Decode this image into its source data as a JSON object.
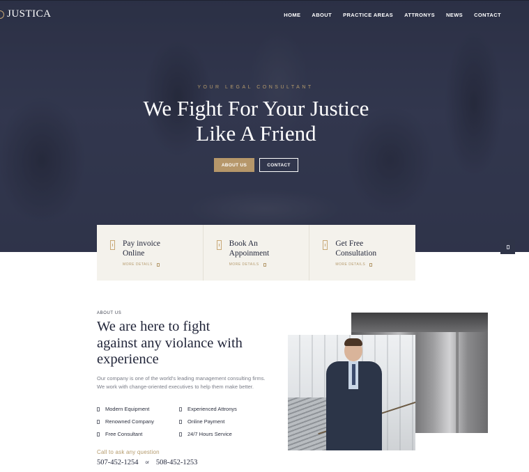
{
  "header": {
    "logo_text": "JUSTICA",
    "nav": [
      "HOME",
      "ABOUT",
      "PRACTICE AREAS",
      "ATTRONYS",
      "NEWS",
      "CONTACT"
    ]
  },
  "hero": {
    "subtitle": "YOUR LEGAL CONSULTANT",
    "title_line1": "We Fight For Your Justice",
    "title_line2": "Like A Friend",
    "about_button": "ABOUT US",
    "contact_button": "CONTACT"
  },
  "cards": [
    {
      "title_line1": "Pay invoice",
      "title_line2": "Online",
      "more": "MORE DETAILS"
    },
    {
      "title_line1": "Book An",
      "title_line2": "Appoinment",
      "more": "MORE DETAILS"
    },
    {
      "title_line1": "Get Free",
      "title_line2": "Consultation",
      "more": "MORE DETAILS"
    }
  ],
  "about": {
    "label": "ABOUT US",
    "title_line1": "We are here to fight",
    "title_line2": "against any violance with",
    "title_line3": "experience",
    "text_line1": "Our company is one of the world's leading management consulting firms.",
    "text_line2": "We work with change-oriented executives to help them make better.",
    "features": [
      "Modern Equipment",
      "Experienced Attronys",
      "Renowned Company",
      "Online Payment",
      "Free Consultant",
      "24/7 Hours Service"
    ],
    "call_label": "Call to ask any question",
    "phone1": "507-452-1254",
    "or": "or",
    "phone2": "508-452-1253"
  },
  "colors": {
    "accent": "#b6976a",
    "navy": "#2f3448",
    "card_bg": "#f4f2ec"
  }
}
